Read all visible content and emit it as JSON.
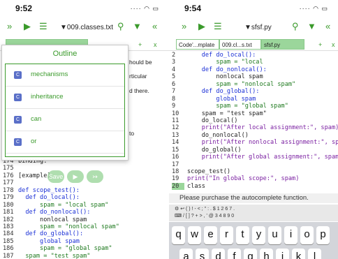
{
  "left": {
    "time": "9:52",
    "filename": "▼009.classes.txt",
    "outline": {
      "title": "Outline",
      "items": [
        {
          "icon": "C",
          "label": "mechanisms"
        },
        {
          "icon": "C",
          "label": "inheritance"
        },
        {
          "icon": "C",
          "label": "can"
        },
        {
          "icon": "C",
          "label": "or"
        }
      ]
    },
    "behind_text": [
      "hould be",
      "rticular",
      "d there.",
      "to"
    ],
    "lines": [
      {
        "n": "174",
        "t": "binding:"
      },
      {
        "n": "175",
        "t": ""
      },
      {
        "n": "176",
        "t": "[example]"
      },
      {
        "n": "177",
        "t": ""
      },
      {
        "n": "178",
        "t": "def scope_test():"
      },
      {
        "n": "179",
        "t": "  def do_local():"
      },
      {
        "n": "180",
        "t": "      spam = \"local spam\""
      },
      {
        "n": "181",
        "t": "  def do_nonlocal():"
      },
      {
        "n": "182",
        "t": "      nonlocal spam"
      },
      {
        "n": "183",
        "t": "      spam = \"nonlocal spam\""
      },
      {
        "n": "184",
        "t": "  def do_global():"
      },
      {
        "n": "185",
        "t": "      global spam"
      },
      {
        "n": "186",
        "t": "      spam = \"global spam\""
      },
      {
        "n": "187",
        "t": "  spam = \"test spam\""
      }
    ],
    "float_buttons": [
      "Save",
      "▶",
      "↣"
    ]
  },
  "right": {
    "time": "9:54",
    "filename": "▼sfsf.py",
    "tabs": [
      "Code'...mplate",
      "009.cl...s.txt",
      "sfsf.py"
    ],
    "popup": {
      "a": "`",
      "b": "~",
      "c": "\\",
      "eq": "="
    },
    "lines": [
      {
        "n": "2",
        "t": "    def do_local():"
      },
      {
        "n": "3",
        "t": "        spam = \"local"
      },
      {
        "n": "4",
        "t": "    def do_nonlocal():"
      },
      {
        "n": "5",
        "t": "        nonlocal spam"
      },
      {
        "n": "6",
        "t": "        spam = \"nonlocal spam\""
      },
      {
        "n": "7",
        "t": "    def do_global():"
      },
      {
        "n": "8",
        "t": "        global spam"
      },
      {
        "n": "9",
        "t": "        spam = \"global spam\""
      },
      {
        "n": "10",
        "t": "    spam = \"test spam\""
      },
      {
        "n": "11",
        "t": "    do_local()"
      },
      {
        "n": "12",
        "t": "    print(\"After local assignment:\", spam)"
      },
      {
        "n": "13",
        "t": "    do_nonlocal()"
      },
      {
        "n": "14",
        "t": "    print(\"After nonlocal assignment:\", spam)"
      },
      {
        "n": "15",
        "t": "    do_global()"
      },
      {
        "n": "16",
        "t": "    print(\"After global assignment:\", spam)"
      },
      {
        "n": "17",
        "t": ""
      },
      {
        "n": "18",
        "t": "scope_test()"
      },
      {
        "n": "19",
        "t": "print(\"In global scope:\", spam)"
      },
      {
        "n": "20",
        "t": "class"
      }
    ],
    "message": "Please purchase the autocomplete function.",
    "keys": [
      "q",
      "w",
      "e",
      "r",
      "t",
      "y",
      "u",
      "i",
      "o",
      "p"
    ],
    "keys2": [
      "a",
      "s",
      "d",
      "f",
      "g",
      "h",
      "j",
      "k",
      "l"
    ]
  },
  "toolbar": {
    "next": "»",
    "play": "▶",
    "list": "☰",
    "search": "🔍",
    "down": "▼",
    "prev": "«",
    "plus": "+",
    "close": "x"
  },
  "colors": {
    "accent": "#3a9a2b",
    "tab_active": "#9bd69b",
    "keyword": "#1a2fd6",
    "string": "#1f7a1f"
  }
}
